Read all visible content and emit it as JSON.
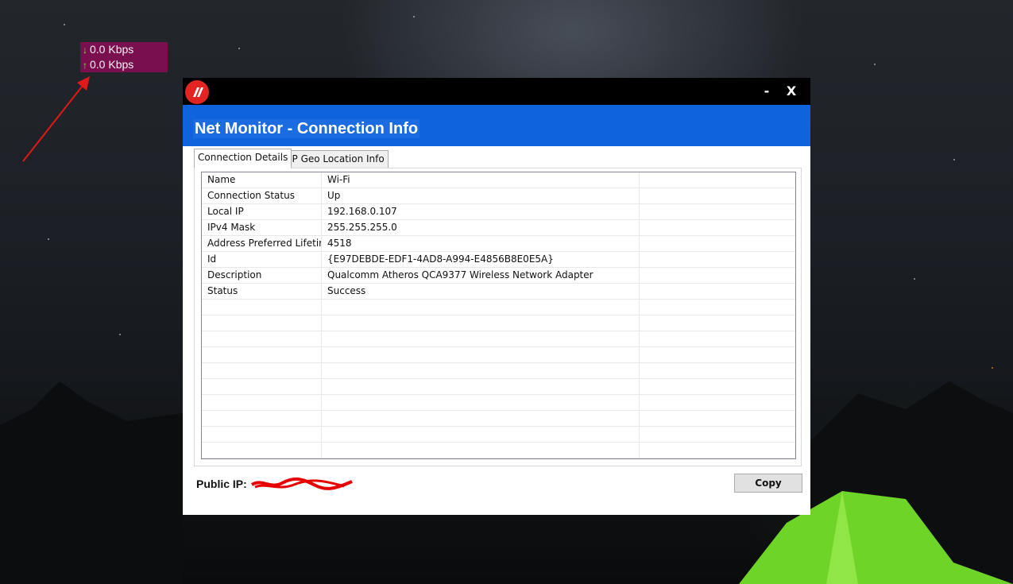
{
  "speed_widget": {
    "download_arrow": "↓",
    "download": "0.0 Kbps",
    "upload_arrow": "↑",
    "upload": "0.0 Kbps",
    "background": "#7a0f4f",
    "arrow_color": "#6ee63a"
  },
  "window": {
    "logo_icon": "app-logo-icon",
    "minimize": "-",
    "close": "X",
    "title": "Net Monitor - Connection Info",
    "header_color": "#0f63dc",
    "tabs": [
      {
        "label": "Connection Details"
      },
      {
        "label": "IP Geo Location Info"
      }
    ],
    "rows": [
      {
        "name": "Name",
        "value": "Wi-Fi"
      },
      {
        "name": "Connection Status",
        "value": "Up"
      },
      {
        "name": "Local IP",
        "value": "192.168.0.107"
      },
      {
        "name": "IPv4 Mask",
        "value": "255.255.255.0"
      },
      {
        "name": "Address Preferred Lifetime",
        "value": "4518"
      },
      {
        "name": "Id",
        "value": "{E97DEBDE-EDF1-4AD8-A994-E4856B8E0E5A}"
      },
      {
        "name": "Description",
        "value": "Qualcomm Atheros QCA9377 Wireless Network Adapter"
      },
      {
        "name": "Status",
        "value": "Success"
      }
    ],
    "public_ip_label": "Public IP:",
    "copy_button": "Copy"
  }
}
